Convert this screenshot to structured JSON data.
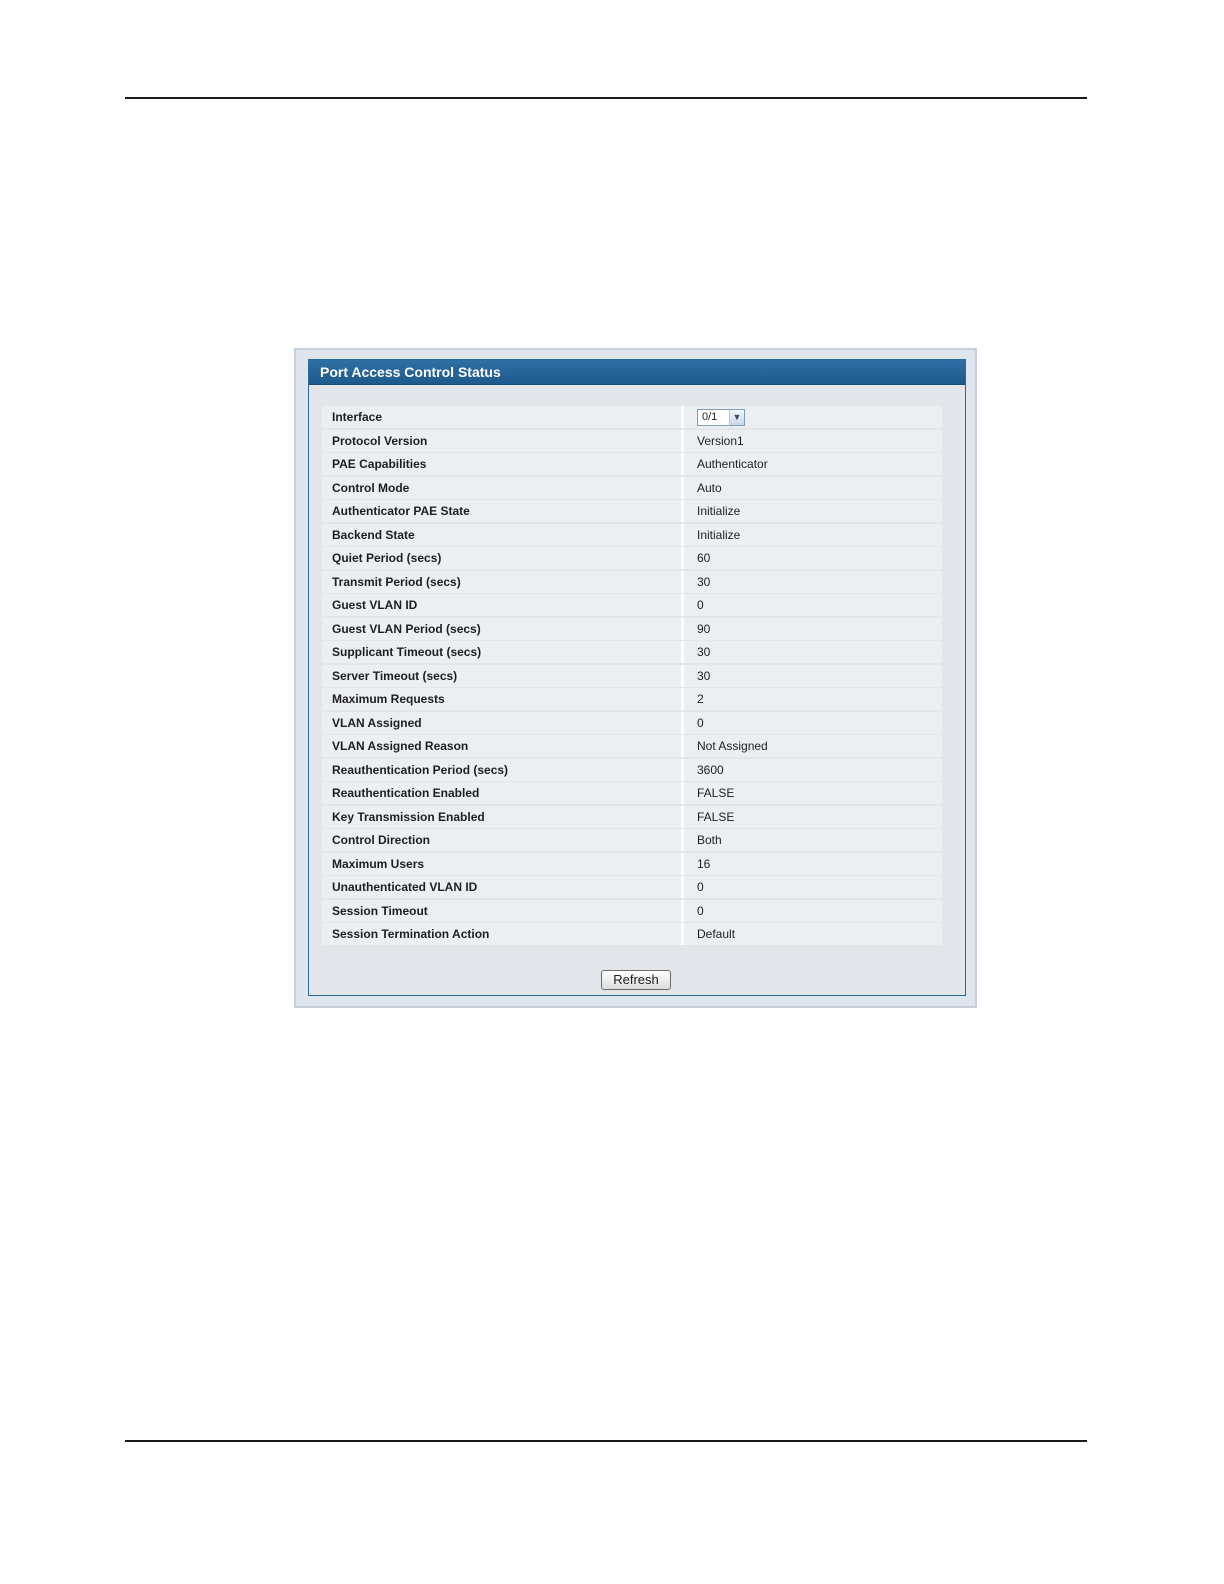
{
  "panel": {
    "title": "Port Access Control Status",
    "refresh_label": "Refresh"
  },
  "interface": {
    "label": "Interface",
    "selected": "0/1"
  },
  "rows": [
    {
      "label": "Protocol Version",
      "value": "Version1"
    },
    {
      "label": "PAE Capabilities",
      "value": "Authenticator"
    },
    {
      "label": "Control Mode",
      "value": "Auto"
    },
    {
      "label": "Authenticator PAE State",
      "value": "Initialize"
    },
    {
      "label": "Backend State",
      "value": "Initialize"
    },
    {
      "label": "Quiet Period (secs)",
      "value": "60"
    },
    {
      "label": "Transmit Period (secs)",
      "value": "30"
    },
    {
      "label": "Guest VLAN ID",
      "value": "0"
    },
    {
      "label": "Guest VLAN Period (secs)",
      "value": "90"
    },
    {
      "label": "Supplicant Timeout (secs)",
      "value": "30"
    },
    {
      "label": "Server Timeout (secs)",
      "value": "30"
    },
    {
      "label": "Maximum Requests",
      "value": "2"
    },
    {
      "label": "VLAN Assigned",
      "value": "0"
    },
    {
      "label": "VLAN Assigned Reason",
      "value": "Not Assigned"
    },
    {
      "label": "Reauthentication Period (secs)",
      "value": "3600"
    },
    {
      "label": "Reauthentication Enabled",
      "value": "FALSE"
    },
    {
      "label": "Key Transmission Enabled",
      "value": "FALSE"
    },
    {
      "label": "Control Direction",
      "value": "Both"
    },
    {
      "label": "Maximum Users",
      "value": "16"
    },
    {
      "label": "Unauthenticated VLAN ID",
      "value": "0"
    },
    {
      "label": "Session Timeout",
      "value": "0"
    },
    {
      "label": "Session Termination Action",
      "value": "Default"
    }
  ]
}
